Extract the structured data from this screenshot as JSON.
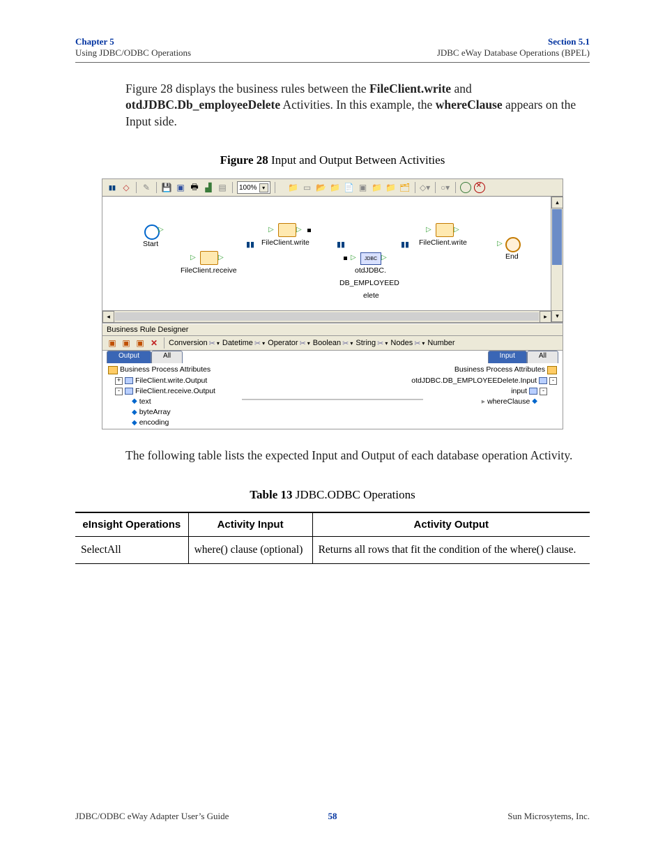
{
  "header": {
    "chapter": "Chapter 5",
    "left_sub": "Using JDBC/ODBC Operations",
    "section": "Section 5.1",
    "right_sub": "JDBC eWay Database Operations (BPEL)"
  },
  "para1": {
    "t1": "Figure 28 displays the business rules between the ",
    "b1": "FileClient.write",
    "t2": " and ",
    "b2": "otdJDBC.Db_employeeDelete",
    "t3": " Activities. In this example, the ",
    "b3": "whereClause",
    "t4": " appears on the Input side."
  },
  "figcap": {
    "bold": "Figure 28",
    "rest": "   Input and Output Between Activities"
  },
  "diagram": {
    "zoom": "100%",
    "start": "Start",
    "receive": "FileClient.receive",
    "write1": "FileClient.write",
    "jdbc_line1": "otdJDBC.",
    "jdbc_line2": "DB_EMPLOYEED",
    "jdbc_line3": "elete",
    "write2": "FileClient.write",
    "end": "End",
    "jdbc_box": "JDBC"
  },
  "brd": {
    "title": "Business Rule Designer",
    "menu": {
      "conversion": "Conversion",
      "datetime": "Datetime",
      "operator": "Operator",
      "boolean": "Boolean",
      "string": "String",
      "nodes": "Nodes",
      "number": "Number"
    },
    "tabs": {
      "output": "Output",
      "all": "All",
      "input": "Input"
    },
    "left": {
      "bpa": "Business Process Attributes",
      "writeOut": "FileClient.write.Output",
      "recvOut": "FileClient.receive.Output",
      "text": "text",
      "byteArray": "byteArray",
      "encoding": "encoding"
    },
    "right": {
      "bpa": "Business Process Attributes",
      "delInput": "otdJDBC.DB_EMPLOYEEDelete.Input",
      "input": "input",
      "where": "whereClause"
    }
  },
  "para2": "The following table lists the expected Input and Output of each database operation Activity.",
  "tabcap": {
    "bold": "Table 13",
    "rest": "   JDBC.ODBC Operations"
  },
  "table": {
    "h1": "eInsight Operations",
    "h2": "Activity Input",
    "h3": "Activity Output",
    "r1c1": "SelectAll",
    "r1c2": "where() clause (optional)",
    "r1c3": "Returns all rows that fit the condition of the where() clause."
  },
  "footer": {
    "left": "JDBC/ODBC eWay Adapter User’s Guide",
    "page": "58",
    "right": "Sun Microsytems, Inc."
  }
}
